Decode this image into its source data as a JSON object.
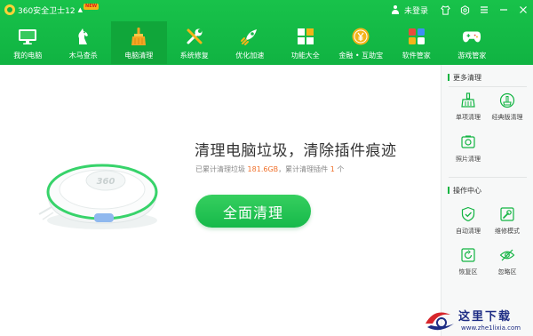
{
  "titlebar": {
    "app_name": "360安全卫士12",
    "badge": "NEW",
    "login": "未登录"
  },
  "nav": [
    {
      "label": "我的电脑",
      "icon": "monitor-icon",
      "active": false
    },
    {
      "label": "木马查杀",
      "icon": "horse-icon",
      "active": false
    },
    {
      "label": "电脑清理",
      "icon": "broom-icon",
      "active": true
    },
    {
      "label": "系统修复",
      "icon": "tools-icon",
      "active": false
    },
    {
      "label": "优化加速",
      "icon": "rocket-icon",
      "active": false
    },
    {
      "label": "功能大全",
      "icon": "grid-icon",
      "active": false
    },
    {
      "label": "金融 • 互助宝",
      "icon": "coin-icon",
      "active": false
    },
    {
      "label": "软件管家",
      "icon": "software-icon",
      "active": false
    },
    {
      "label": "游戏管家",
      "icon": "gamepad-icon",
      "active": false
    }
  ],
  "main": {
    "headline": "清理电脑垃圾，清除插件痕迹",
    "stats_prefix": "已累计清理垃圾 ",
    "stats_size": "181.6GB",
    "stats_middle": "，累计清理插件 ",
    "stats_count": "1",
    "stats_suffix": " 个",
    "button_label": "全面清理",
    "robot_logo": "360"
  },
  "sidebar": {
    "more_title": "更多清理",
    "more_items": [
      {
        "label": "单项清理",
        "icon": "broom-icon"
      },
      {
        "label": "经典版清理",
        "icon": "classic-clean-icon"
      },
      {
        "label": "照片清理",
        "icon": "photo-icon"
      }
    ],
    "ops_title": "操作中心",
    "ops_items": [
      {
        "label": "自动清理",
        "icon": "shield-check-icon"
      },
      {
        "label": "维修模式",
        "icon": "repair-icon"
      },
      {
        "label": "恢复区",
        "icon": "restore-icon"
      },
      {
        "label": "忽略区",
        "icon": "ignore-icon"
      }
    ]
  },
  "watermark": {
    "cn": "这里下载",
    "url": "www.zhe1lixia.com"
  },
  "colors": {
    "brand_green": "#11b441",
    "highlight_orange": "#f0712b"
  }
}
